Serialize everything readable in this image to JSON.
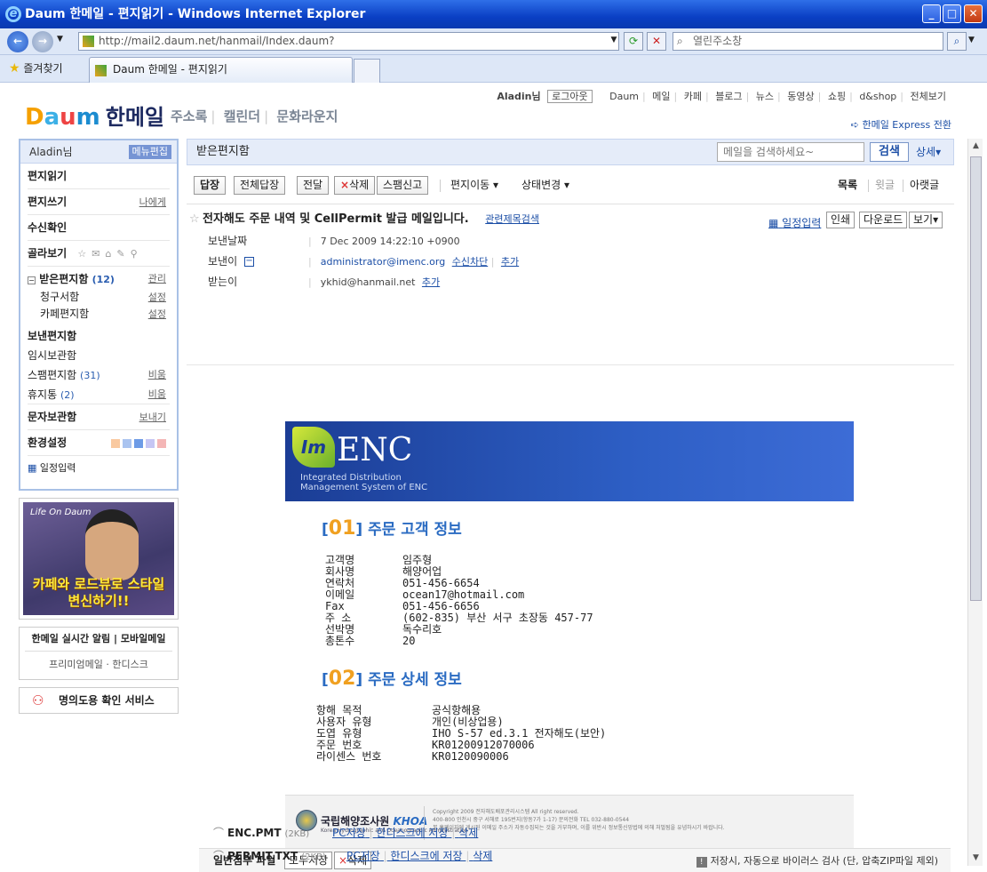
{
  "window": {
    "title": "Daum 한메일 - 편지읽기 - Windows Internet Explorer"
  },
  "browser": {
    "url": "http://mail2.daum.net/hanmail/Index.daum?",
    "search_placeholder": "열린주소창",
    "favorites": "즐겨찾기",
    "tab_title": "Daum 한메일 - 편지읽기"
  },
  "header": {
    "logo_brand": "Daum",
    "logo_service": "한메일",
    "services": [
      "주소록",
      "캘린더",
      "문화라운지"
    ],
    "user": "Aladin님",
    "logout": "로그아웃",
    "top_links": [
      "Daum",
      "메일",
      "카페",
      "블로그",
      "뉴스",
      "동영상",
      "쇼핑",
      "d&shop",
      "전체보기"
    ],
    "express": "한메일 Express 전환"
  },
  "sidebar": {
    "user": "Aladin님",
    "menu_edit": "메뉴편집",
    "read": "편지읽기",
    "write": "편지쓰기",
    "write_self": "나에게",
    "receipt": "수신확인",
    "filter": "골라보기",
    "inbox": "받은편지함",
    "inbox_count": "(12)",
    "inbox_manage": "관리",
    "sub1": "청구서함",
    "sub2": "카페편지함",
    "setting": "설정",
    "sent": "보낸편지함",
    "draft": "임시보관함",
    "spam": "스팸편지함",
    "spam_count": "(31)",
    "trash": "휴지통",
    "trash_count": "(2)",
    "empty": "비움",
    "sms": "문자보관함",
    "sms_send": "보내기",
    "env": "환경설정",
    "env_colors": [
      "#f9c9a0",
      "#aac4f0",
      "#6d9be6",
      "#c6c6f4",
      "#f4b6b6"
    ],
    "schedule": "일정입력"
  },
  "ad": {
    "brand": "Life On Daum",
    "caption": "카페와 로드뷰로 스타일 변신하기!!"
  },
  "alarm": {
    "title": "한메일 실시간 알림 | 모바일메일",
    "links": "프리미엄메일 · 한디스크"
  },
  "honor": "명의도용 확인 서비스",
  "mail": {
    "folder": "받은편지함",
    "search_placeholder": "메일을 검색하세요~",
    "search_btn": "검색",
    "detail": "상세",
    "tb_reply": "답장",
    "tb_replyall": "전체답장",
    "tb_forward": "전달",
    "tb_delete": "삭제",
    "tb_spam": "스팸신고",
    "tb_move": "편지이동",
    "tb_status": "상태변경",
    "tb_list": "목록",
    "tb_prev": "윗글",
    "tb_next": "아랫글",
    "subject": "전자해도 주문 내역 및 CellPermit 발급 메일입니다.",
    "related": "관련제목검색",
    "schedule": "일정입력",
    "print": "인쇄",
    "download": "다운로드",
    "view": "보기",
    "date_label": "보낸날짜",
    "date": "7 Dec 2009 14:22:10 +0900",
    "from_label": "보낸이",
    "from": "administrator@imenc.org",
    "block": "수신차단",
    "add": "추가",
    "to_label": "받는이",
    "to": "ykhid@hanmail.net"
  },
  "body": {
    "banner_im": "Im",
    "banner_enc": "ENC",
    "banner_sub1": "Integrated Distribution",
    "banner_sub2": "Management System of ENC",
    "sec1_num": "01",
    "sec1_title": "주문 고객 정보",
    "customer": [
      {
        "k": "고객명",
        "v": "임주형"
      },
      {
        "k": "회사명",
        "v": "해양어업"
      },
      {
        "k": "연락처",
        "v": "051-456-6654"
      },
      {
        "k": "이메일",
        "v": "ocean17@hotmail.com"
      },
      {
        "k": "Fax",
        "v": "051-456-6656"
      },
      {
        "k": "주 소",
        "v": "(602-835) 부산 서구 초장동 457-77"
      },
      {
        "k": "선박명",
        "v": "독수리호"
      },
      {
        "k": "총톤수",
        "v": "20"
      }
    ],
    "sec2_num": "02",
    "sec2_title": "주문 상세 정보",
    "order": [
      {
        "k": "항해 목적",
        "v": "공식항해용"
      },
      {
        "k": "사용자 유형",
        "v": "개인(비상업용)"
      },
      {
        "k": "도엽 유형",
        "v": "IHO S-57 ed.3.1 전자해도(보안)"
      },
      {
        "k": "주문 번호",
        "v": "KR01200912070006"
      },
      {
        "k": "라이센스 번호",
        "v": "KR0120090006"
      }
    ],
    "footer_org": "국립해양조사원",
    "footer_khoa": "KHOA",
    "footer_eng": "Korea Hydrographic and Oceanographic Administration",
    "footer_copy1": "Copyright 2009 전자해도배포관리시스템 All right reserved.",
    "footer_copy2": "400-800 인천시 중구 서해로 195번지(항동7가 1-17) 문의전화 TEL 032-880-0544",
    "footer_copy3": "본 홈페이지에 게시된 이메일 주소가 자동수집되는 것을 거부하며, 이를 위반시 정보통신망법에 의해 처벌됨을 유념하시기 바랍니다."
  },
  "attach": {
    "title": "일반첨부 파일",
    "save_all": "모두저장",
    "delete": "삭제",
    "note": "저장시, 자동으로 바이러스 검사 (단, 압축ZIP파일 제외)",
    "files": [
      {
        "name": "ENC.PMT",
        "size": "(2KB)"
      },
      {
        "name": "PERMIT.TXT",
        "size": "(2KB)"
      }
    ],
    "pc_save": "PC저장",
    "disk_save": "한디스크에 저장",
    "del": "삭제"
  }
}
